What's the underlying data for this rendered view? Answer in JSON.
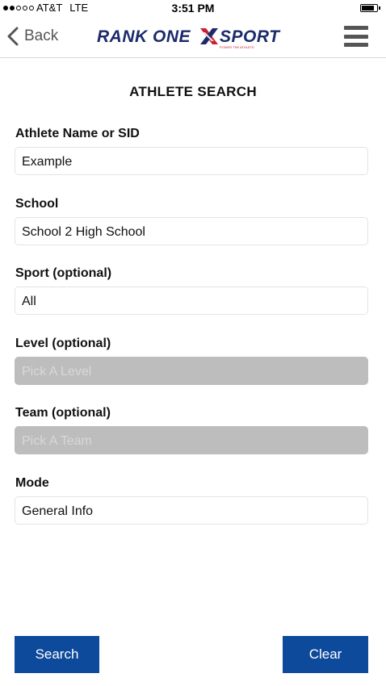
{
  "status": {
    "carrier": "AT&T",
    "network": "LTE",
    "time": "3:51 PM"
  },
  "nav": {
    "back_label": "Back",
    "logo_word1": "RANK ONE",
    "logo_word2": "SPORT",
    "logo_tagline": "POWER THE ATHLETE"
  },
  "page": {
    "title": "ATHLETE SEARCH"
  },
  "form": {
    "athlete": {
      "label": "Athlete Name or SID",
      "value": "Example"
    },
    "school": {
      "label": "School",
      "value": "School 2 High School"
    },
    "sport": {
      "label": "Sport (optional)",
      "value": "All"
    },
    "level": {
      "label": "Level (optional)",
      "placeholder": "Pick A Level"
    },
    "team": {
      "label": "Team (optional)",
      "placeholder": "Pick A Team"
    },
    "mode": {
      "label": "Mode",
      "value": "General Info"
    }
  },
  "actions": {
    "search_label": "Search",
    "clear_label": "Clear"
  },
  "colors": {
    "accent": "#0d4a9b",
    "logo_navy": "#1b2a6b",
    "logo_red": "#c8202f",
    "disabled": "#bdbdbd"
  }
}
